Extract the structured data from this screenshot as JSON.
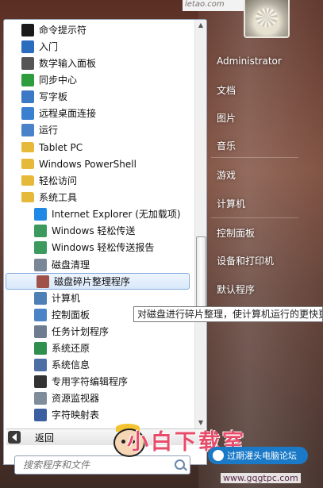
{
  "watermark_top": "letao.com",
  "programs": [
    {
      "label": "命令提示符",
      "icon": "cmd-icon",
      "indent": 0,
      "color": "#1a1a1a"
    },
    {
      "label": "入门",
      "icon": "getting-started-icon",
      "indent": 0,
      "color": "#2a6dbf"
    },
    {
      "label": "数学输入面板",
      "icon": "math-input-icon",
      "indent": 0,
      "color": "#555555"
    },
    {
      "label": "同步中心",
      "icon": "sync-center-icon",
      "indent": 0,
      "color": "#2e9e3c"
    },
    {
      "label": "写字板",
      "icon": "wordpad-icon",
      "indent": 0,
      "color": "#3b78c6"
    },
    {
      "label": "远程桌面连接",
      "icon": "remote-desktop-icon",
      "indent": 0,
      "color": "#3a7fd0"
    },
    {
      "label": "运行",
      "icon": "run-icon",
      "indent": 0,
      "color": "#4a82c9"
    },
    {
      "label": "Tablet PC",
      "icon": "folder-icon",
      "indent": 0,
      "color": "#e7b93a"
    },
    {
      "label": "Windows PowerShell",
      "icon": "folder-icon",
      "indent": 0,
      "color": "#e7b93a"
    },
    {
      "label": "轻松访问",
      "icon": "folder-icon",
      "indent": 0,
      "color": "#e7b93a"
    },
    {
      "label": "系统工具",
      "icon": "folder-icon",
      "indent": 0,
      "color": "#e7b93a"
    },
    {
      "label": "Internet Explorer (无加载项)",
      "icon": "internet-explorer-icon",
      "indent": 1,
      "color": "#1e88e5"
    },
    {
      "label": "Windows 轻松传送",
      "icon": "easy-transfer-icon",
      "indent": 1,
      "color": "#3c9a5f"
    },
    {
      "label": "Windows 轻松传送报告",
      "icon": "easy-transfer-report-icon",
      "indent": 1,
      "color": "#3c9a5f"
    },
    {
      "label": "磁盘清理",
      "icon": "disk-cleanup-icon",
      "indent": 1,
      "color": "#7a8796"
    },
    {
      "label": "磁盘碎片整理程序",
      "icon": "disk-defragmenter-icon",
      "indent": 1,
      "color": "#a0524a",
      "selected": true
    },
    {
      "label": "计算机",
      "icon": "computer-icon",
      "indent": 1,
      "color": "#4e7fb5"
    },
    {
      "label": "控制面板",
      "icon": "control-panel-icon",
      "indent": 1,
      "color": "#4a84c7"
    },
    {
      "label": "任务计划程序",
      "icon": "task-scheduler-icon",
      "indent": 1,
      "color": "#6d7c8e"
    },
    {
      "label": "系统还原",
      "icon": "system-restore-icon",
      "indent": 1,
      "color": "#2f8f4e"
    },
    {
      "label": "系统信息",
      "icon": "system-info-icon",
      "indent": 1,
      "color": "#4d6fa5"
    },
    {
      "label": "专用字符编辑程序",
      "icon": "private-char-editor-icon",
      "indent": 1,
      "color": "#333333"
    },
    {
      "label": "资源监视器",
      "icon": "resource-monitor-icon",
      "indent": 1,
      "color": "#7f8c9a"
    },
    {
      "label": "字符映射表",
      "icon": "character-map-icon",
      "indent": 1,
      "color": "#3b5fa0"
    }
  ],
  "back_label": "返回",
  "search_placeholder": "搜索程序和文件",
  "right_pane": {
    "user": "Administrator",
    "items": [
      "文档",
      "图片",
      "音乐",
      "游戏",
      "计算机",
      "控制面板",
      "设备和打印机",
      "默认程序"
    ]
  },
  "tooltip": "对磁盘进行碎片整理，使计算机运行的更快更",
  "brand_text": "小白下载室",
  "badge_text": "过期灌头电脑论坛",
  "site_text": "www.gqgtpc.com"
}
